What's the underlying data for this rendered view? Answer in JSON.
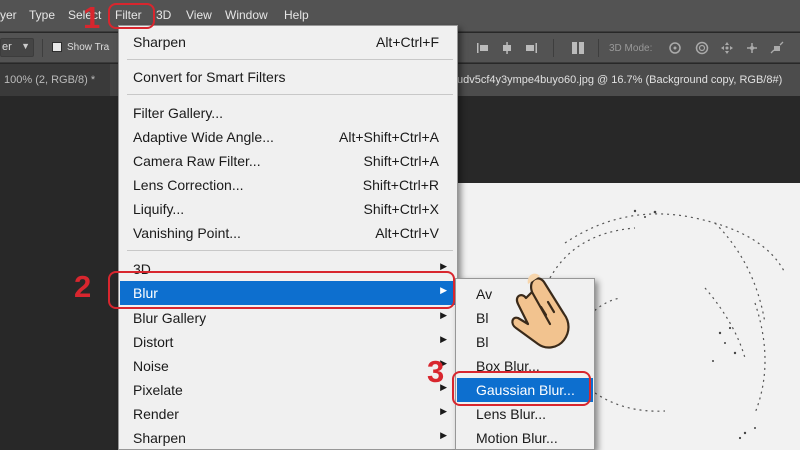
{
  "menubar": {
    "items": [
      "yer",
      "Type",
      "Select",
      "Filter",
      "3D",
      "View",
      "Window",
      "Help"
    ]
  },
  "options_bar": {
    "select_value": "er",
    "show_transform": "Show Tra",
    "mode_3d_label": "3D Mode:"
  },
  "tabs": {
    "left": "100% (2, RGB/8) *",
    "active": "udv5cf4y3ympe4buyo60.jpg @ 16.7% (Background copy, RGB/8#)"
  },
  "filter_menu": {
    "items": [
      {
        "label": "Sharpen",
        "shortcut": "Alt+Ctrl+F"
      },
      {
        "label": "Convert for Smart Filters",
        "shortcut": ""
      },
      {
        "label": "Filter Gallery...",
        "shortcut": ""
      },
      {
        "label": "Adaptive Wide Angle...",
        "shortcut": "Alt+Shift+Ctrl+A"
      },
      {
        "label": "Camera Raw Filter...",
        "shortcut": "Shift+Ctrl+A"
      },
      {
        "label": "Lens Correction...",
        "shortcut": "Shift+Ctrl+R"
      },
      {
        "label": "Liquify...",
        "shortcut": "Shift+Ctrl+X"
      },
      {
        "label": "Vanishing Point...",
        "shortcut": "Alt+Ctrl+V"
      },
      {
        "label": "3D",
        "shortcut": ""
      },
      {
        "label": "Blur",
        "shortcut": ""
      },
      {
        "label": "Blur Gallery",
        "shortcut": ""
      },
      {
        "label": "Distort",
        "shortcut": ""
      },
      {
        "label": "Noise",
        "shortcut": ""
      },
      {
        "label": "Pixelate",
        "shortcut": ""
      },
      {
        "label": "Render",
        "shortcut": ""
      },
      {
        "label": "Sharpen",
        "shortcut": ""
      }
    ]
  },
  "blur_menu": {
    "items": [
      "Av",
      "Bl",
      "Bl",
      "Box Blur...",
      "Gaussian Blur...",
      "Lens Blur...",
      "Motion Blur..."
    ]
  },
  "annotations": {
    "step1": "1",
    "step2": "2",
    "step3": "3"
  },
  "colors": {
    "highlight": "#0d6fcf",
    "annotation_red": "#d8262e",
    "menu_bg": "#f0f0f0",
    "chrome": "#535353"
  }
}
